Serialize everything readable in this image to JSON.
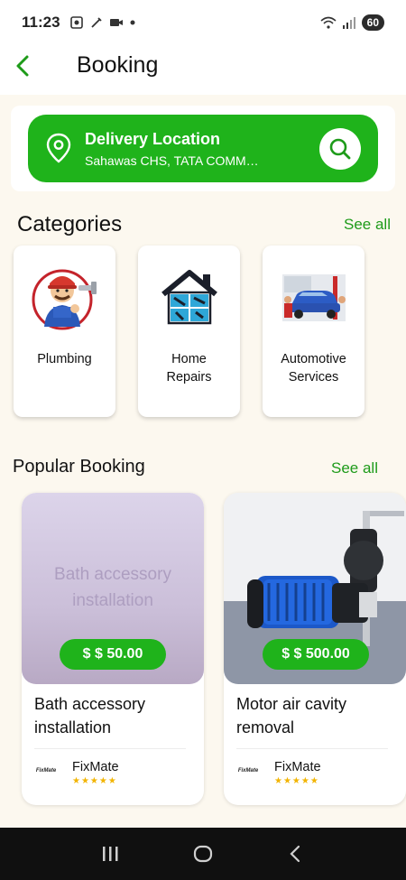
{
  "status": {
    "time": "11:23",
    "battery": "60"
  },
  "header": {
    "title": "Booking"
  },
  "location": {
    "title": "Delivery Location",
    "address": "Sahawas CHS, TATA COMMUNICATIONS"
  },
  "categories": {
    "heading": "Categories",
    "see_all": "See all",
    "items": [
      {
        "label": "Plumbing",
        "icon": "plumber-icon"
      },
      {
        "label": "Home\nRepairs",
        "icon": "home-repair-icon"
      },
      {
        "label": "Automotive\nServices",
        "icon": "car-service-icon"
      }
    ]
  },
  "popular": {
    "heading": "Popular Booking",
    "see_all": "See all",
    "items": [
      {
        "image_text": "Bath accessory installation",
        "price": "$ $ 50.00",
        "title": "Bath accessory installation",
        "provider": "FixMate",
        "logo_text": "FixMate",
        "rating": "★★★★★"
      },
      {
        "image_text": "",
        "price": "$ $ 500.00",
        "title": "Motor air cavity removal",
        "provider": "FixMate",
        "logo_text": "FixMate",
        "rating": "★★★★★"
      }
    ]
  },
  "colors": {
    "accent": "#1fb31b",
    "background": "#fcf8ef",
    "star": "#f2b400"
  }
}
